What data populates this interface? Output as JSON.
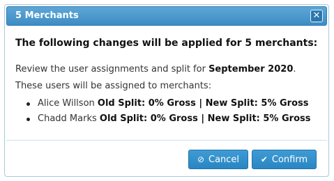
{
  "dialog": {
    "title": "5 Merchants",
    "close_glyph": "✕",
    "heading": "The following changes will be applied for 5 merchants:",
    "review_prefix": "Review the user assignments and split for ",
    "review_period": "September 2020",
    "review_suffix": ".",
    "assign_text": "These users will be assigned to merchants:",
    "users": [
      {
        "name": "Alice Willson",
        "detail": "Old Split: 0% Gross | New Split: 5% Gross"
      },
      {
        "name": "Chadd Marks",
        "detail": "Old Split: 0% Gross | New Split: 5% Gross"
      }
    ],
    "cancel_label": "Cancel",
    "confirm_label": "Confirm",
    "cancel_icon": "⊘",
    "confirm_icon": "✔"
  }
}
